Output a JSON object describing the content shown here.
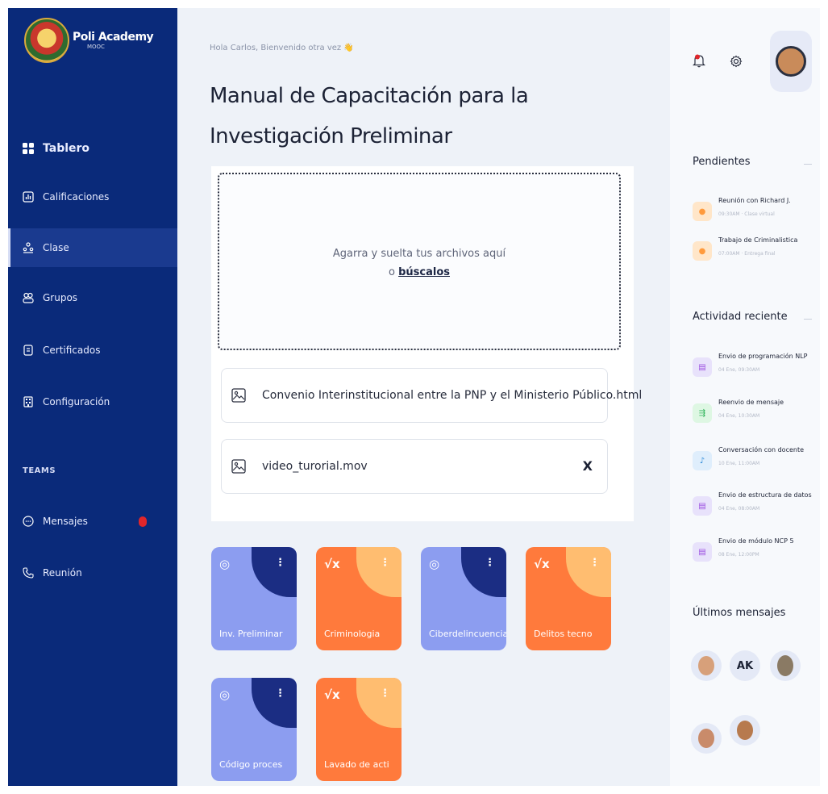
{
  "app": {
    "name": "Poli Academy",
    "subtitle": "MOOC"
  },
  "sidebar": {
    "items": [
      {
        "label": "Tablero",
        "icon": "dashboard-icon"
      },
      {
        "label": "Calificaciones",
        "icon": "chart-icon"
      },
      {
        "label": "Clase",
        "icon": "class-icon"
      },
      {
        "label": "Grupos",
        "icon": "groups-icon"
      },
      {
        "label": "Certificados",
        "icon": "certificate-icon"
      },
      {
        "label": "Configuración",
        "icon": "settings-icon"
      }
    ],
    "teams_label": "TEAMS",
    "team_items": [
      {
        "label": "Mensajes",
        "icon": "message-icon"
      },
      {
        "label": "Reunión",
        "icon": "phone-icon"
      }
    ]
  },
  "main": {
    "greeting": "Hola Carlos, Bienvenido otra vez 👋",
    "title": "Manual de Capacitación para la Investigación Preliminar",
    "dropzone": {
      "line1": "Agarra y suelta tus archivos aquí",
      "prefix": "o",
      "link": "búscalos"
    },
    "files": [
      {
        "name": "Convenio Interinstitucional entre la PNP y el Ministerio Público.html",
        "icon": "image-file-icon"
      },
      {
        "name": "video_turorial.mov",
        "icon": "image-file-icon",
        "close": "X"
      }
    ],
    "courses": [
      {
        "label": "Inv. Preliminar",
        "color": "#8c9df0",
        "icon": "globe-icon"
      },
      {
        "label": "Criminologia",
        "color": "#ff7a3c",
        "icon": "sqrt-icon"
      },
      {
        "label": "Ciberdelincuencia",
        "color": "#8c9df0",
        "icon": "globe-icon"
      },
      {
        "label": "Delitos tecno",
        "color": "#ff7a3c",
        "icon": "sqrt-icon"
      },
      {
        "label": "Código proces",
        "color": "#8c9df0",
        "icon": "globe-icon"
      },
      {
        "label": "Lavado de acti",
        "color": "#ff7a3c",
        "icon": "sqrt-icon"
      }
    ]
  },
  "right": {
    "pending_title": "Pendientes",
    "pending": [
      {
        "title": "Reunión con Richard J.",
        "sub": "09:30AM · Clase virtual"
      },
      {
        "title": "Trabajo de Criminalistica",
        "sub": "07:00AM · Entrega final"
      }
    ],
    "activity_title": "Actividad reciente",
    "activity": [
      {
        "title": "Envio de programación NLP",
        "sub": "04 Ene, 09:30AM",
        "color": "#e8e2fb",
        "icon": "clipboard-icon"
      },
      {
        "title": "Reenvio de mensaje",
        "sub": "04 Ene, 10:30AM",
        "color": "#def7e3",
        "icon": "forward-icon"
      },
      {
        "title": "Conversación con docente",
        "sub": "10 Ene, 11:00AM",
        "color": "#dfeefc",
        "icon": "mic-icon"
      },
      {
        "title": "Envio de estructura de datos",
        "sub": "04 Ene, 08:00AM",
        "color": "#e8e2fb",
        "icon": "clipboard-icon"
      },
      {
        "title": "Envio de módulo NCP 5",
        "sub": "08 Ene, 12:00PM",
        "color": "#e8e2fb",
        "icon": "clipboard-icon"
      }
    ],
    "messages_title": "Últimos mensajes",
    "message_initials": "AK"
  },
  "colors": {
    "sidebar": "#0a2a7a",
    "accent_purple": "#8c9df0",
    "accent_orange": "#ff7a3c",
    "badge": "#e0262b"
  }
}
